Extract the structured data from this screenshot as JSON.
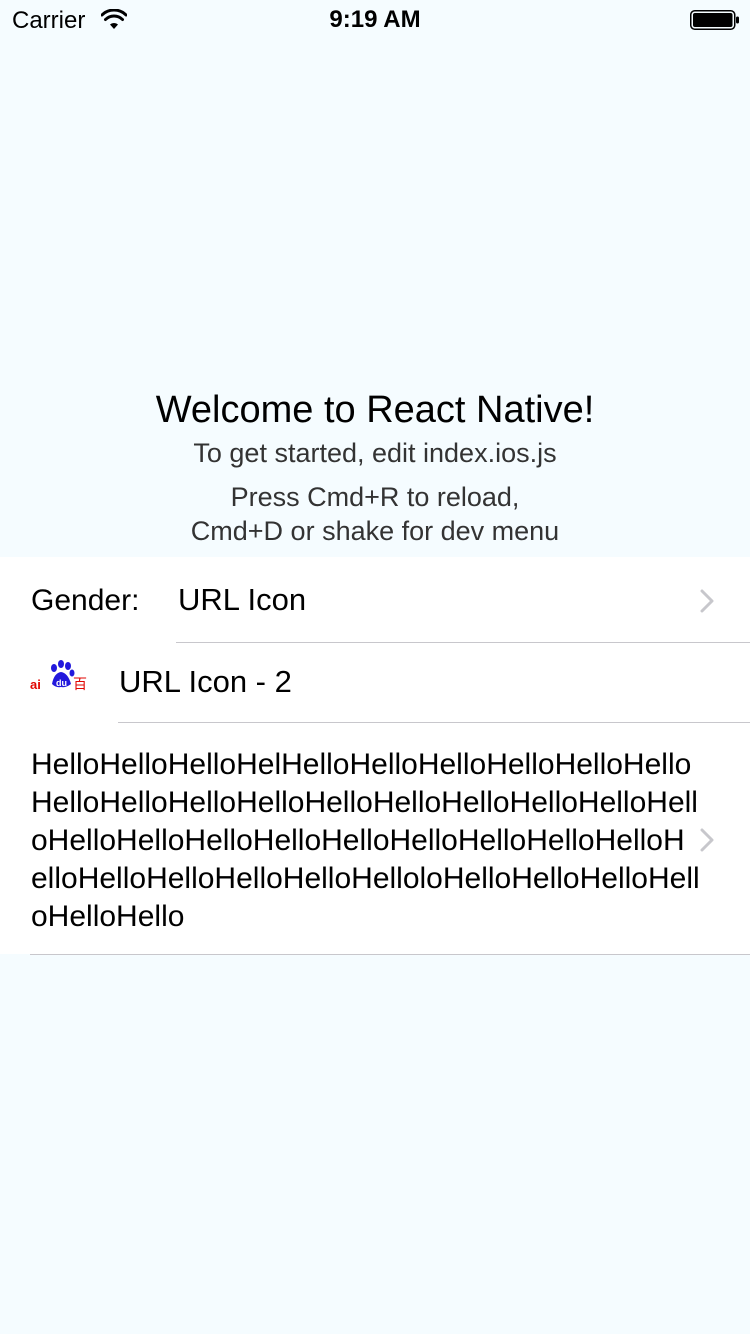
{
  "status_bar": {
    "carrier": "Carrier",
    "time": "9:19 AM",
    "wifi_icon": "wifi-icon",
    "battery_icon": "battery-icon"
  },
  "welcome": {
    "title": "Welcome to React Native!",
    "line1": "To get started, edit index.ios.js",
    "line2a": "Press Cmd+R to reload,",
    "line2b": "Cmd+D or shake for dev menu"
  },
  "list": {
    "row1": {
      "label": "Gender:",
      "value": "URL Icon",
      "accessory": "chevron-right-icon"
    },
    "row2": {
      "icon": "baidu-logo-icon",
      "logo_text": "Bai du 百",
      "value": "URL Icon - 2"
    },
    "row3": {
      "text": "HelloHelloHelloHelHelloHelloHelloHelloHelloHelloHelloHelloHelloHelloHelloHelloHelloHelloHelloHelloHelloHelloHelloHelloHelloHelloHelloHelloHelloHelloHelloHelloHelloHelloHelloloHelloHelloHelloHelloHelloHello",
      "accessory": "chevron-right-icon"
    }
  },
  "colors": {
    "background": "#F5FCFF",
    "list_background": "#FFFFFF",
    "separator": "#C8C7CC",
    "chevron": "#C7C7CC",
    "instructions": "#333333",
    "baidu_blue": "#2319DC",
    "baidu_red": "#E10602"
  }
}
